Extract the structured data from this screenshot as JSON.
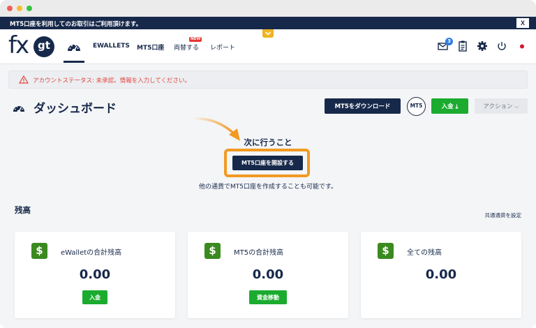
{
  "notice": {
    "text": "MT5口座を利用してのお取引はご利用頂けます。",
    "close_label": "X"
  },
  "header": {
    "logo_fx": "fx",
    "logo_gt": "gt",
    "nav": {
      "ewallets": "EWALLETS",
      "mt5": "MT5口座",
      "exchange": "両替する",
      "exchange_badge": "NEW",
      "report": "レポート"
    },
    "mail_count": "3",
    "icons": [
      "dashboard-icon",
      "mail-icon",
      "clipboard-icon",
      "gear-icon",
      "power-icon",
      "japan-flag-icon"
    ]
  },
  "alert": {
    "text": "アカウントステータス: 未承認。情報を入力してください。",
    "color": "#e1453d"
  },
  "dashboard": {
    "title": "ダッシュボード",
    "download_label": "MT5をダウンロード",
    "mt5_badge": "MT5",
    "deposit_label": "入金 ⤓",
    "action_label": "アクション ⌵"
  },
  "next_step": {
    "title": "次に行うこと",
    "button_label": "MT5口座を開設する",
    "note": "他の通貨でMT5口座を作成することも可能です。"
  },
  "balance": {
    "heading": "残高",
    "currency_link": "共通通貨を設定",
    "cards": [
      {
        "label": "eWalletの合計残高",
        "value": "0.00",
        "button": "入金"
      },
      {
        "label": "MT5の合計残高",
        "value": "0.00",
        "button": "資金移動"
      },
      {
        "label": "全ての残高",
        "value": "0.00"
      }
    ],
    "currency_symbol": "$"
  },
  "colors": {
    "navy": "#17294a",
    "green": "#1bab2f",
    "orange": "#f29a22",
    "red": "#e1453d"
  }
}
